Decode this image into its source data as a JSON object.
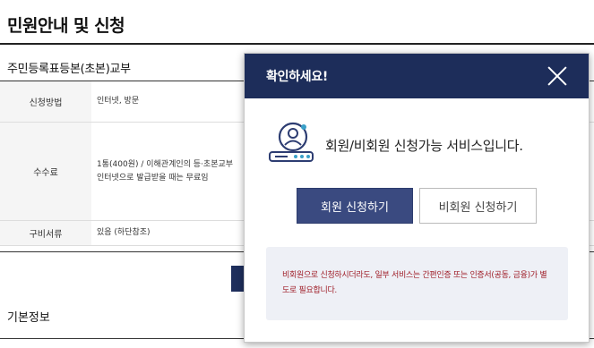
{
  "page": {
    "title": "민원안내 및 신청",
    "section_title": "주민등록표등본(초본)교부",
    "basic_info_title": "기본정보"
  },
  "info_table": {
    "rows": [
      {
        "label": "신청방법",
        "value": [
          "인터넷, 방문"
        ]
      },
      {
        "label": "수수료",
        "value": [
          "1통(400원) / 이해관계인의 등·초본교부",
          "인터넷으로 발급받을 때는 무료임"
        ]
      },
      {
        "label": "구비서류",
        "value": [
          "있음 (하단참조)"
        ]
      }
    ]
  },
  "modal": {
    "title": "확인하세요!",
    "close_icon": "close-icon",
    "message": "회원/비회원 신청가능 서비스입니다.",
    "member_button": "회원 신청하기",
    "guest_button": "비회원 신청하기",
    "notice": "비회원으로 신청하시더라도, 일부 서비스는 간편인증 또는 인증서(공동, 금융)가 별도로 필요합니다.",
    "colors": {
      "header": "#1d2d5a",
      "member_button": "#3a4a80",
      "notice_text": "#a0202a",
      "notice_bg": "#eef0f6"
    }
  }
}
